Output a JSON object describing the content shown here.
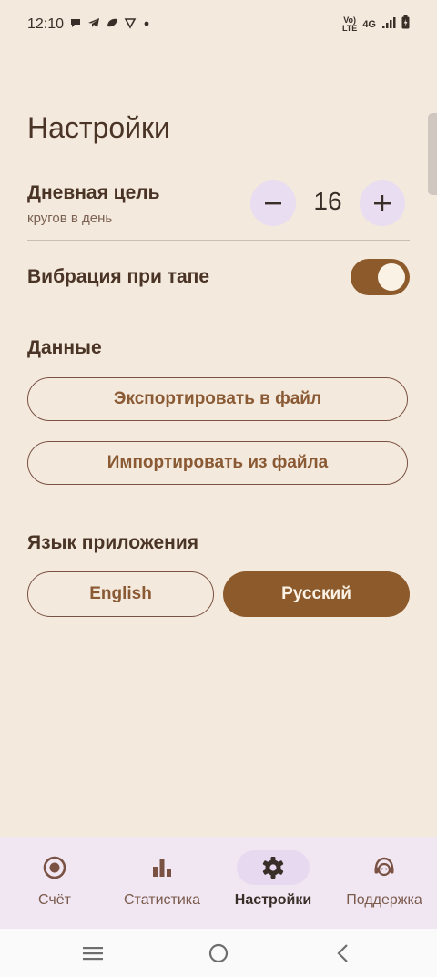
{
  "status_bar": {
    "time": "12:10",
    "volte": "Vo)",
    "lte": "LTE",
    "network": "4G",
    "left_icons": [
      "message-icon",
      "telegram-icon",
      "leaf-icon",
      "shield-icon",
      "dot-icon"
    ]
  },
  "settings": {
    "title": "Настройки",
    "daily_goal": {
      "label": "Дневная цель",
      "sublabel": "кругов в день",
      "value": "16"
    },
    "vibration": {
      "label": "Вибрация при тапе",
      "enabled": true
    },
    "data": {
      "label": "Данные",
      "export_label": "Экспортировать в файл",
      "import_label": "Импортировать из файла"
    },
    "language": {
      "label": "Язык приложения",
      "options": [
        "English",
        "Русский"
      ],
      "selected": "Русский"
    }
  },
  "bottom_nav": {
    "items": [
      {
        "label": "Счёт",
        "icon": "target-icon"
      },
      {
        "label": "Статистика",
        "icon": "bar-chart-icon"
      },
      {
        "label": "Настройки",
        "icon": "gear-icon"
      },
      {
        "label": "Поддержка",
        "icon": "support-icon"
      }
    ],
    "active": "Настройки"
  },
  "colors": {
    "background": "#f4e9dd",
    "accent": "#8c5a2b",
    "nav_background": "#f1e7f2",
    "stepper_background": "#e8ddf1"
  }
}
